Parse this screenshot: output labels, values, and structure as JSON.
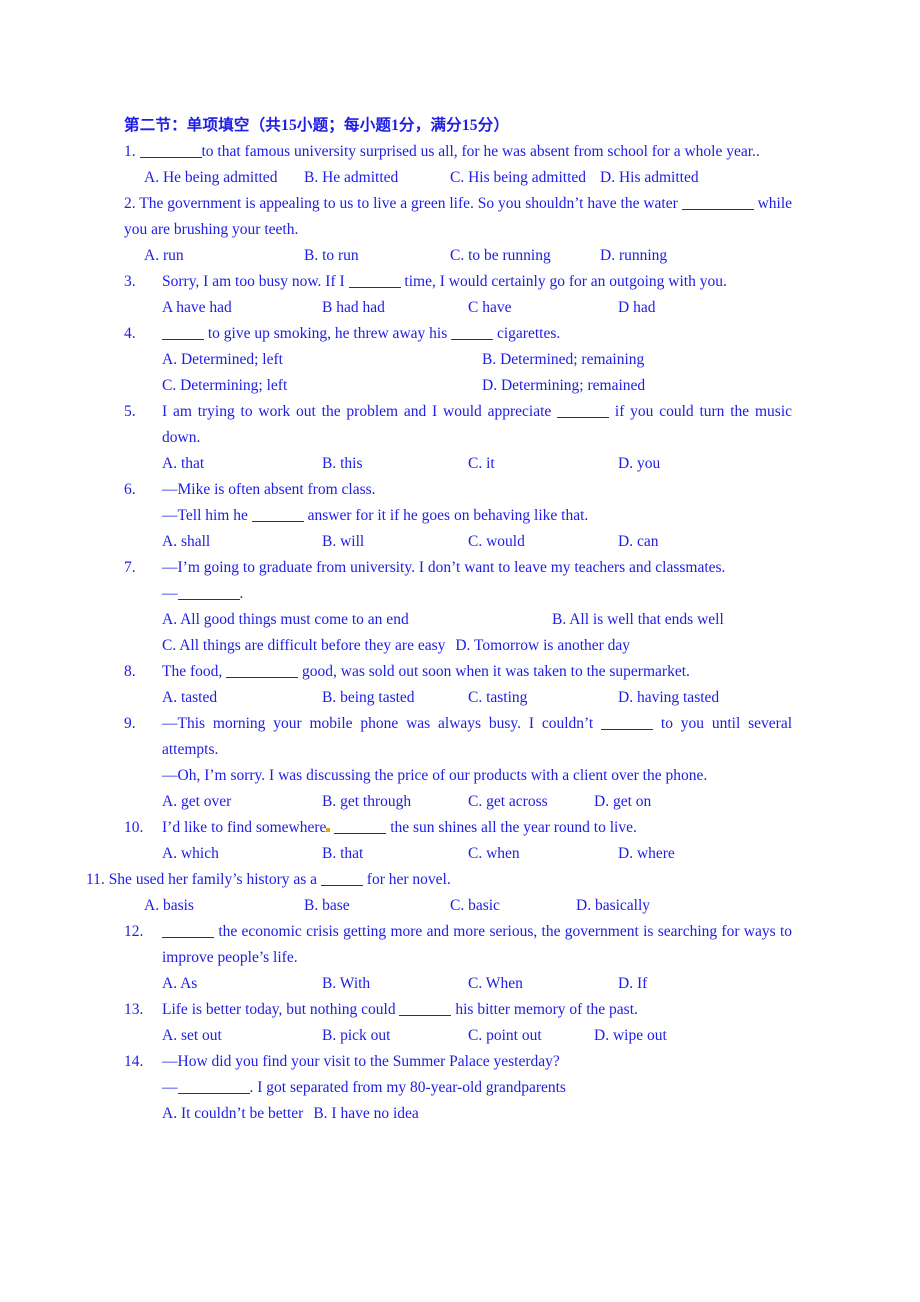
{
  "document": {
    "section_heading": "第二节：单项填空（共15小题；每小题1分，满分15分）",
    "text_color": "#1d1de6"
  },
  "questions": [
    {
      "number": "1.",
      "stem_before_blank": "",
      "stem_after_blank": "to that famous university surprised us all, for he was absent from school for a whole year..",
      "options": [
        {
          "label": "A. He being admitted"
        },
        {
          "label": "B. He admitted"
        },
        {
          "label": "C. His being admitted"
        },
        {
          "label": "D. His admitted"
        }
      ]
    },
    {
      "number": "2.",
      "stem_before_blank": "The government is appealing to us to live a green life. So you shouldn’t have the water",
      "stem_after_blank": "while you are brushing your teeth.",
      "options": [
        {
          "label": "A. run"
        },
        {
          "label": "B. to run"
        },
        {
          "label": "C. to be running"
        },
        {
          "label": "D. running"
        }
      ]
    },
    {
      "number": "3.",
      "stem_before_blank": "Sorry, I am too busy now. If I",
      "stem_after_blank": "time, I would certainly go for an outgoing with you.",
      "options": [
        {
          "label": "A have had"
        },
        {
          "label": "B had had"
        },
        {
          "label": "C have"
        },
        {
          "label": "D had"
        }
      ]
    },
    {
      "number": "4.",
      "stem_before_blank": "",
      "stem_mid": "to give up smoking, he threw away his",
      "stem_after_blank": "cigarettes.",
      "options": [
        {
          "label": "A. Determined; left"
        },
        {
          "label": "B. Determined; remaining"
        },
        {
          "label": "C. Determining; left"
        },
        {
          "label": "D. Determining; remained"
        }
      ]
    },
    {
      "number": "5.",
      "stem_before_blank": "I am trying to work out the problem and I would appreciate",
      "stem_after_blank": "if you could turn the music down.",
      "options": [
        {
          "label": "A. that"
        },
        {
          "label": "B. this"
        },
        {
          "label": "C. it"
        },
        {
          "label": "D. you"
        }
      ]
    },
    {
      "number": "6.",
      "line1": "—Mike is often absent from class.",
      "line2_before_blank": "—Tell him he",
      "line2_after_blank": "answer for it if he goes on behaving like that.",
      "options": [
        {
          "label": "A. shall"
        },
        {
          "label": "B. will"
        },
        {
          "label": "C. would"
        },
        {
          "label": "D. can"
        }
      ]
    },
    {
      "number": "7.",
      "line1": "—I’m going to graduate from university. I don’t want to leave my teachers and classmates.",
      "line2_prefix": "—",
      "line2_suffix": ".",
      "options": [
        {
          "label": "A. All good things must come to an end"
        },
        {
          "label": "B. All is well that ends well"
        },
        {
          "label": "C. All things are difficult before they are easy"
        },
        {
          "label": "D. Tomorrow is another day"
        }
      ]
    },
    {
      "number": "8.",
      "stem_before_blank": "The food,",
      "stem_after_blank": "good, was sold out soon when it was taken to the supermarket.",
      "options": [
        {
          "label": "A. tasted"
        },
        {
          "label": "B. being tasted"
        },
        {
          "label": "C. tasting"
        },
        {
          "label": "D. having tasted"
        }
      ]
    },
    {
      "number": "9.",
      "line1_before_blank": "—This morning your mobile phone was always busy. I couldn’t",
      "line1_after_blank": "to you until several attempts.",
      "line2": "—Oh, I’m sorry. I was discussing the price of our products with a client over the phone.",
      "options": [
        {
          "label": "A. get over"
        },
        {
          "label": "B. get through"
        },
        {
          "label": "C. get across"
        },
        {
          "label": "D. get on"
        }
      ]
    },
    {
      "number": "10.",
      "stem_before_blank": "I’d like to find somewhere",
      "stem_after_blank": "the sun shines all the year round to live.",
      "options": [
        {
          "label": "A. which"
        },
        {
          "label": "B. that"
        },
        {
          "label": "C. when"
        },
        {
          "label": "D. where"
        }
      ]
    },
    {
      "number": "11.",
      "stem_before_blank": "She used her family’s history as a",
      "stem_after_blank": "for her novel.",
      "options": [
        {
          "label": "A. basis"
        },
        {
          "label": "B. base"
        },
        {
          "label": "C. basic"
        },
        {
          "label": "D. basically"
        }
      ]
    },
    {
      "number": "12.",
      "stem_before_blank": "",
      "stem_after_blank": "the economic crisis getting more and more serious, the government is searching for ways to improve people’s life.",
      "options": [
        {
          "label": "A. As"
        },
        {
          "label": "B. With"
        },
        {
          "label": "C. When"
        },
        {
          "label": "D. If"
        }
      ]
    },
    {
      "number": "13.",
      "stem_before_blank": "Life is better today, but nothing could",
      "stem_after_blank": "his bitter memory of the past.",
      "options": [
        {
          "label": "A. set out"
        },
        {
          "label": "B. pick out"
        },
        {
          "label": "C. point out"
        },
        {
          "label": "D. wipe out"
        }
      ]
    },
    {
      "number": "14.",
      "line1": "—How did you find your visit to the Summer Palace yesterday?",
      "line2_prefix": "—",
      "line2_suffix": ". I got separated from my 80-year-old grandparents",
      "options": [
        {
          "label": "A. It couldn’t be better"
        },
        {
          "label": "B. I have no idea"
        }
      ]
    }
  ]
}
